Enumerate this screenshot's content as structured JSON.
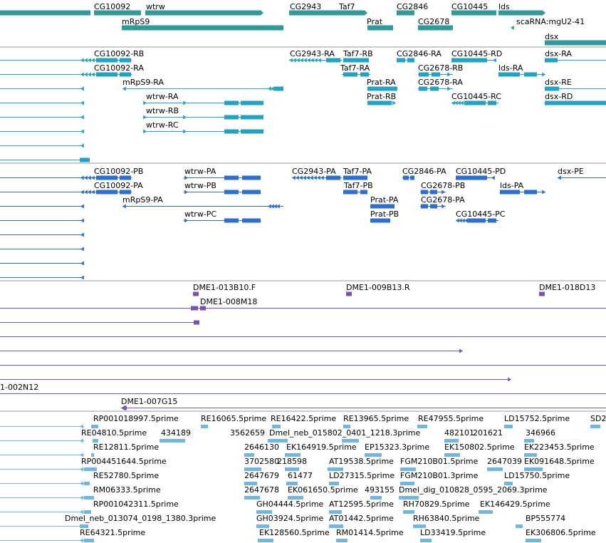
{
  "colors": {
    "genes": "#2f9a9a",
    "transcripts": "#21a2c9",
    "proteins": "#2a6fd1",
    "clones": "#7a52b3",
    "ests": "#71b6dd",
    "separator": "#9a9a9a",
    "text": "#000000"
  },
  "tracks": {
    "genes": {
      "labels": [
        "CG10092",
        "wtrw",
        "CG2943",
        "Taf7",
        "CG2846",
        "CG10445",
        "lds",
        "mRpS9",
        "Prat",
        "CG2678",
        "scaRNA:mgU2-41",
        "dsx"
      ]
    },
    "transcripts": {
      "labels": [
        "CG10092-RB",
        "CG10092-RA",
        "mRpS9-RA",
        "wtrw-RA",
        "wtrw-RB",
        "wtrw-RC",
        "CG2943-RA",
        "Taf7-RB",
        "Taf7-RA",
        "Prat-RA",
        "Prat-RB",
        "CG2846-RA",
        "CG2678-RB",
        "CG2678-RA",
        "CG10445-RD",
        "CG10445-RC",
        "lds-RA",
        "dsx-RA",
        "dsx-RE",
        "dsx-RD"
      ]
    },
    "proteins": {
      "labels": [
        "CG10092-PB",
        "CG10092-PA",
        "mRpS9-PA",
        "wtrw-PA",
        "wtrw-PB",
        "wtrw-PC",
        "CG2943-PA",
        "Taf7-PA",
        "Taf7-PB",
        "Prat-PA",
        "Prat-PB",
        "CG2846-PA",
        "CG2678-PB",
        "CG2678-PA",
        "CG10445-PD",
        "CG10445-PC",
        "lds-PA",
        "dsx-PE"
      ]
    },
    "clones": {
      "labels": [
        "DME1-013B10.F",
        "DME1-008M18",
        "DME1-009B13.R",
        "DME1-018D13",
        "1-002N12",
        "DME1-007G15"
      ]
    },
    "ests": {
      "labels": [
        "RP001018997.5prime",
        "RE16065.5prime",
        "RE16422.5prime",
        "RE13965.5prime",
        "RE47955.5prime",
        "LD15752.5prime",
        "SD2",
        "RE04810.5prime",
        "434189",
        "3562659",
        "Dmel_neb_015802_0401_1218.3prime",
        "482101",
        "201621",
        "346966",
        "RE12811.5prime",
        "2646130",
        "EK164919.5prime",
        "EP15323.3prime",
        "EK150802.5prime",
        "EK223453.5prime",
        "RP004451644.5prime",
        "3702580",
        "218598",
        "AT19538.5prime",
        "FGM210B01.5prime",
        "2647039",
        "EK091648.5prime",
        "RE52780.5prime",
        "2647679",
        "61477",
        "LD27315.5prime",
        "FGM210B01.3prime",
        "LD15750.5prime",
        "RM06333.5prime",
        "2647678",
        "EK061650.5prime",
        "493155",
        "Dmel_dig_010828_0595_2069.3prime",
        "RP001042311.5prime",
        "GH04444.5prime",
        "AT12595.5prime",
        "RH70829.5prime",
        "EK146429.5prime",
        "Dmel_neb_013074_0198_1380.3prime",
        "GH03924.5prime",
        "AT01442.5prime",
        "RH63840.5prime",
        "BP555774",
        "RE64321.5prime",
        "EK128560.5prime",
        "RM01414.5prime",
        "LD33419.5prime",
        "EK306806.5prime"
      ]
    }
  }
}
